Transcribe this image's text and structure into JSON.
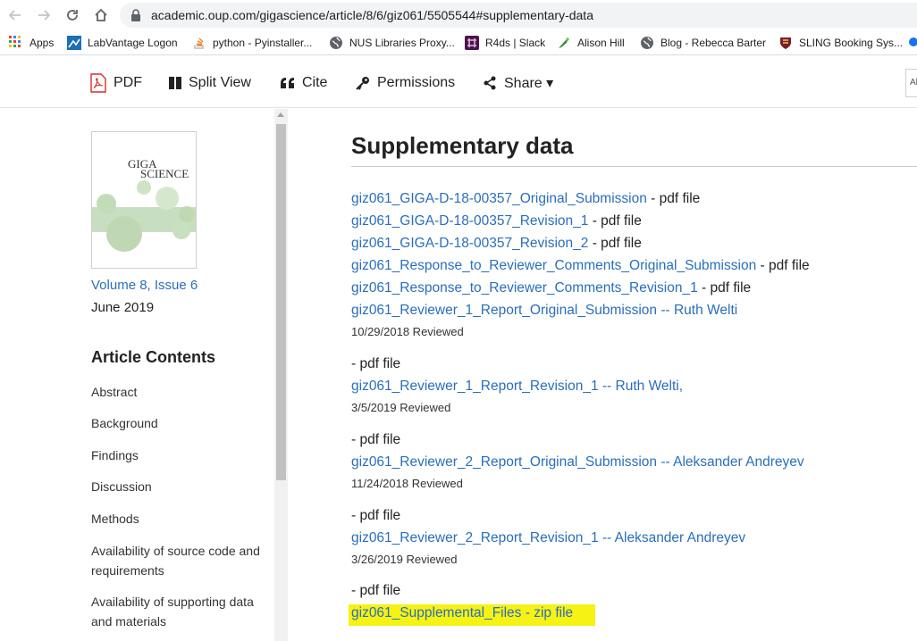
{
  "browser": {
    "url": "academic.oup.com/gigascience/article/8/6/giz061/5505544#supplementary-data",
    "bookmarks": [
      {
        "label": "Apps",
        "icon": "apps-grid-icon"
      },
      {
        "label": "LabVantage Logon",
        "icon": "labvantage-icon"
      },
      {
        "label": "python - Pyinstaller...",
        "icon": "stackoverflow-icon"
      },
      {
        "label": "NUS Libraries Proxy...",
        "icon": "globe-icon"
      },
      {
        "label": "R4ds | Slack",
        "icon": "slack-icon"
      },
      {
        "label": "Alison Hill",
        "icon": "bird-icon"
      },
      {
        "label": "Blog - Rebecca Barter",
        "icon": "globe-icon"
      },
      {
        "label": "SLING Booking Sys...",
        "icon": "crest-icon"
      }
    ]
  },
  "toolbar": {
    "pdf": "PDF",
    "split_view": "Split View",
    "cite": "Cite",
    "permissions": "Permissions",
    "share": "Share ▾",
    "search_stub": "Al"
  },
  "sidebar": {
    "cover_text": "GIGA SCIENCE",
    "volume": "Volume 8, Issue 6",
    "date": "June 2019",
    "contents_heading": "Article Contents",
    "toc": [
      "Abstract",
      "Background",
      "Findings",
      "Discussion",
      "Methods",
      "Availability of source code and requirements",
      "Availability of supporting data and materials"
    ]
  },
  "main": {
    "heading": "Supplementary data",
    "files": [
      {
        "link": "giz061_GIGA-D-18-00357_Original_Submission",
        "suffix": " - pdf file"
      },
      {
        "link": "giz061_GIGA-D-18-00357_Revision_1",
        "suffix": " - pdf file"
      },
      {
        "link": "giz061_GIGA-D-18-00357_Revision_2",
        "suffix": " - pdf file"
      },
      {
        "link": "giz061_Response_to_Reviewer_Comments_Original_Submission",
        "suffix": " - pdf file"
      },
      {
        "link": "giz061_Response_to_Reviewer_Comments_Revision_1",
        "suffix": " - pdf file"
      }
    ],
    "reports": [
      {
        "link": "giz061_Reviewer_1_Report_Original_Submission -- Ruth Welti",
        "reviewed": "10/29/2018 Reviewed",
        "suffix": "- pdf file"
      },
      {
        "link": "giz061_Reviewer_1_Report_Revision_1 -- Ruth Welti,",
        "reviewed": "3/5/2019 Reviewed",
        "suffix": "- pdf file"
      },
      {
        "link": "giz061_Reviewer_2_Report_Original_Submission -- Aleksander Andreyev",
        "reviewed": "11/24/2018 Reviewed",
        "suffix": "- pdf file"
      },
      {
        "link": "giz061_Reviewer_2_Report_Revision_1 -- Aleksander Andreyev",
        "reviewed": "3/26/2019 Reviewed",
        "suffix": "- pdf file"
      }
    ],
    "supplemental": {
      "link": "giz061_Supplemental_Files",
      "suffix": " - zip file"
    },
    "highlight_color": "#f5f214",
    "link_color": "#2a6ebb"
  }
}
